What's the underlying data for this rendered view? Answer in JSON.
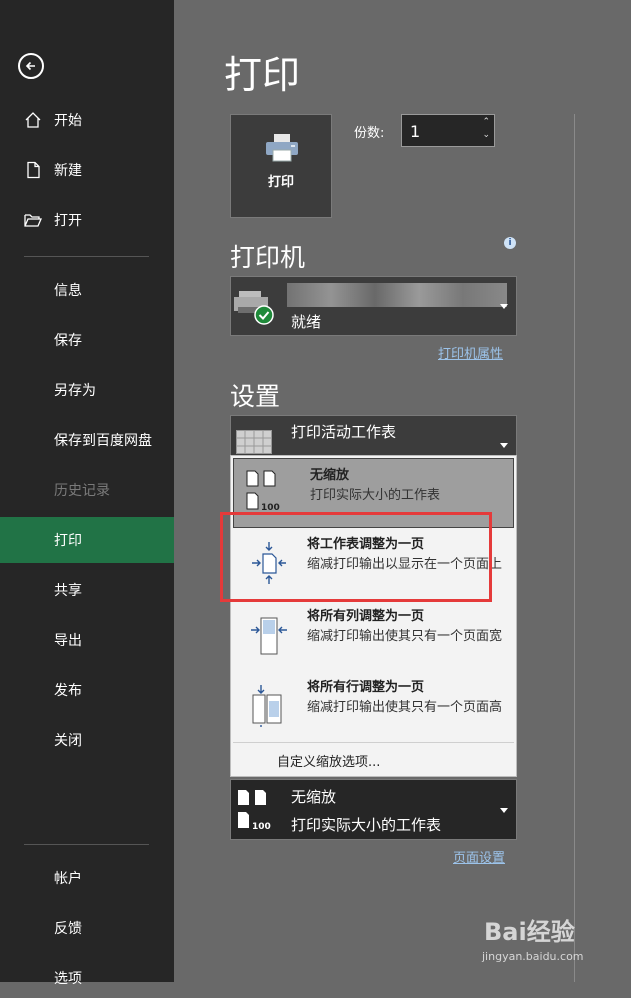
{
  "sidebar": {
    "top_items": [
      {
        "label": "开始",
        "icon": "home-icon"
      },
      {
        "label": "新建",
        "icon": "new-file-icon"
      },
      {
        "label": "打开",
        "icon": "open-folder-icon"
      }
    ],
    "items": [
      {
        "label": "信息"
      },
      {
        "label": "保存"
      },
      {
        "label": "另存为"
      },
      {
        "label": "保存到百度网盘"
      },
      {
        "label": "历史记录",
        "disabled": true
      },
      {
        "label": "打印",
        "active": true
      },
      {
        "label": "共享"
      },
      {
        "label": "导出"
      },
      {
        "label": "发布"
      },
      {
        "label": "关闭"
      }
    ],
    "bottom_items": [
      {
        "label": "帐户"
      },
      {
        "label": "反馈"
      },
      {
        "label": "选项"
      }
    ]
  },
  "main": {
    "title": "打印",
    "print_button_label": "打印",
    "copies_label": "份数:",
    "copies_value": "1"
  },
  "printer": {
    "section_title": "打印机",
    "status": "就绪",
    "properties_link": "打印机属性"
  },
  "settings": {
    "section_title": "设置",
    "scope_label": "打印活动工作表",
    "scaling_options": [
      {
        "title": "无缩放",
        "desc": "打印实际大小的工作表",
        "selected": true
      },
      {
        "title": "将工作表调整为一页",
        "desc": "缩减打印输出以显示在一个页面上"
      },
      {
        "title": "将所有列调整为一页",
        "desc": "缩减打印输出使其只有一个页面宽"
      },
      {
        "title": "将所有行调整为一页",
        "desc": "缩减打印输出使其只有一个页面高"
      }
    ],
    "custom_scaling": "自定义缩放选项...",
    "current_scaling_title": "无缩放",
    "current_scaling_desc": "打印实际大小的工作表",
    "page_setup_link": "页面设置"
  },
  "watermark": {
    "brand": "Bai经验",
    "url": "jingyan.baidu.com"
  },
  "colors": {
    "active_green": "#217346",
    "highlight_red": "#e53a3a",
    "link_blue": "#9cc3ea"
  }
}
